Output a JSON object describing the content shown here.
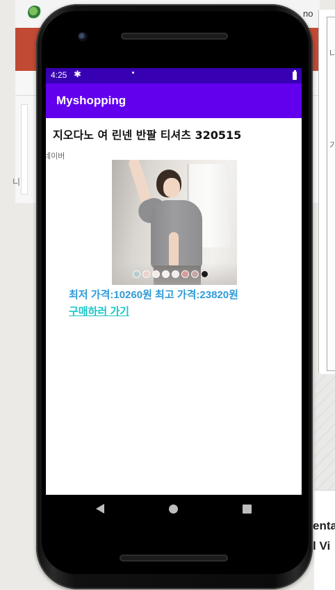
{
  "background": {
    "top_text": "no",
    "right_glyph_1": "나",
    "right_glyph_2": "기",
    "left_glyph": "니",
    "right_text_1": "enta",
    "right_text_2": "l Vi"
  },
  "statusbar": {
    "time": "4:25",
    "settings_icon": "gear-icon",
    "battery_icon": "battery-icon"
  },
  "appbar": {
    "title": "Myshopping",
    "color": "#6200ee",
    "status_color": "#3700b3"
  },
  "product": {
    "title": "지오다노 여 린넨 반팔 티셔츠 320515",
    "source": "네이버",
    "slider": {
      "swatch_colors": [
        "#b7cbd0",
        "#e9d2cc",
        "#f2e9e6",
        "#f4f2f0",
        "#f3ece8",
        "#d79a98",
        "#c4a5a5",
        "#1a1a1a"
      ]
    },
    "price_text": "최저 가격:10260원 최고 가격:23820원",
    "buy_link": "구매하러 가기",
    "price_color": "#2f9ad8",
    "link_color": "#19c5c9"
  },
  "navbar": {
    "back_icon": "back-triangle-icon",
    "home_icon": "home-circle-icon",
    "recent_icon": "recent-square-icon"
  }
}
